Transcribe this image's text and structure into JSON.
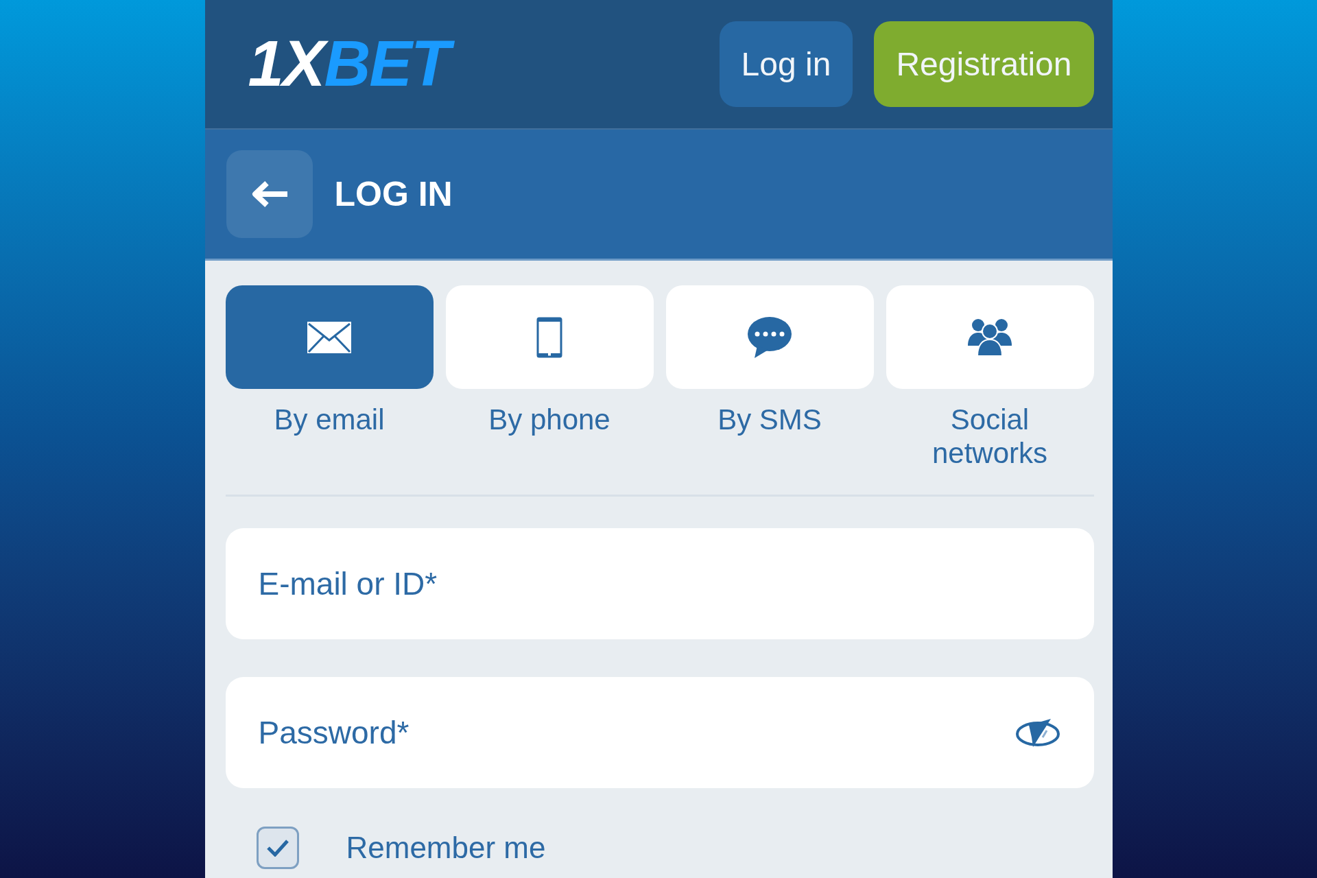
{
  "header": {
    "logo": {
      "part_1": "1X",
      "part_2": "BET"
    },
    "buttons": [
      {
        "label": "Log in",
        "kind": "secondary"
      },
      {
        "label": "Registration",
        "kind": "primary"
      }
    ]
  },
  "page_header": {
    "title": "LOG IN"
  },
  "login_methods": [
    {
      "label": "By email",
      "selected": true
    },
    {
      "label": "By phone",
      "selected": false
    },
    {
      "label": "By SMS",
      "selected": false
    },
    {
      "label": "Social networks",
      "selected": false
    }
  ],
  "fields": [
    {
      "placeholder": "E-mail or ID*",
      "kind": "text"
    },
    {
      "placeholder": "Password*",
      "kind": "password"
    }
  ],
  "remember_me": {
    "label": "Remember me",
    "checked": true
  }
}
